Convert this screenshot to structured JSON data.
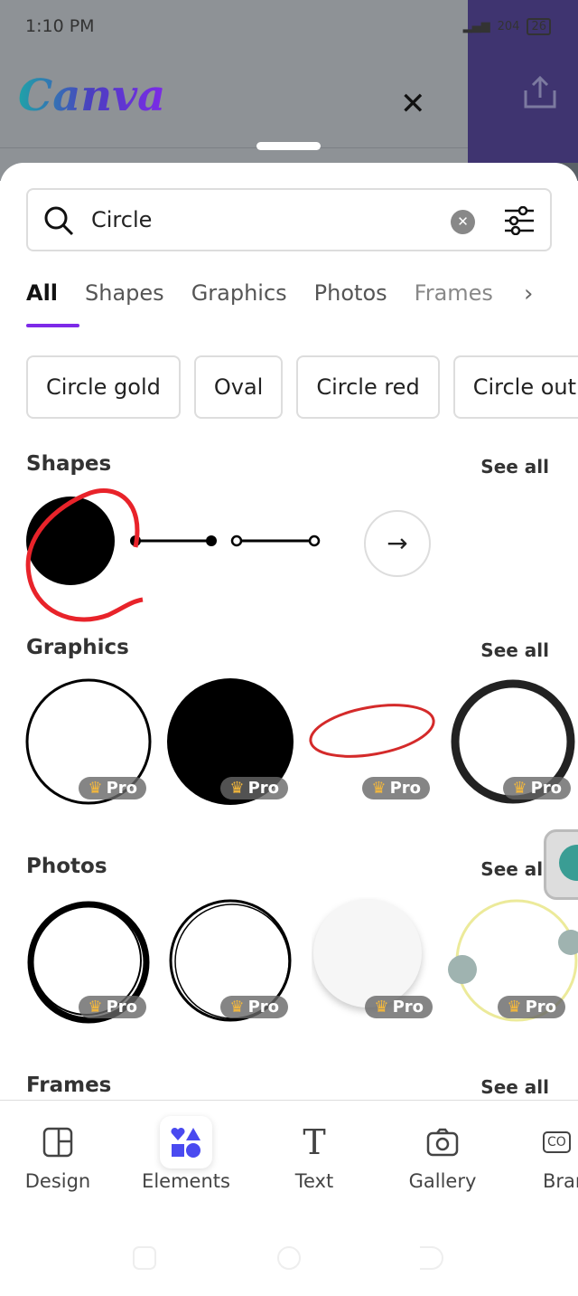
{
  "status": {
    "time": "1:10 PM",
    "speed": "204",
    "battery": "26"
  },
  "header": {
    "logo": "Canva"
  },
  "search": {
    "value": "Circle"
  },
  "tabs": [
    {
      "label": "All"
    },
    {
      "label": "Shapes"
    },
    {
      "label": "Graphics"
    },
    {
      "label": "Photos"
    },
    {
      "label": "Frames"
    }
  ],
  "chips": [
    {
      "label": "Circle gold"
    },
    {
      "label": "Oval"
    },
    {
      "label": "Circle red"
    },
    {
      "label": "Circle outl"
    }
  ],
  "sections": {
    "shapes": "Shapes",
    "graphics": "Graphics",
    "photos": "Photos",
    "frames": "Frames",
    "see_all": "See all"
  },
  "pro_label": "Pro",
  "nav": [
    {
      "label": "Design"
    },
    {
      "label": "Elements"
    },
    {
      "label": "Text"
    },
    {
      "label": "Gallery"
    },
    {
      "label": "Bran"
    }
  ],
  "colors": {
    "accent": "#7d2ae8",
    "elements_icon": "#4a4af0",
    "annotation": "#e8232a"
  }
}
